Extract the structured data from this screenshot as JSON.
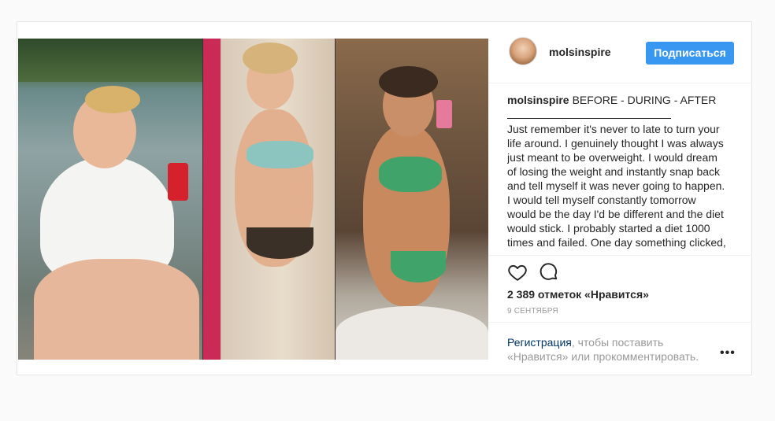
{
  "post": {
    "username": "molsinspire",
    "follow_label": "Подписаться",
    "caption_title": "BEFORE - DURING - AFTER",
    "caption_lines": [
      "Just remember it's never to late to turn your",
      "life around. I genuinely thought I was always",
      "just meant to be overweight. I would dream",
      "of losing the weight and instantly snap back",
      "and tell myself it was never going to happen.",
      "I would tell myself constantly tomorrow",
      "would be the day I'd be different and the diet",
      "would stick. I probably started a diet 1000",
      "times and failed. One day something clicked,"
    ],
    "likes": "2 389 отметок «Нравится»",
    "date": "9 СЕНТЯБРЯ",
    "login_link": "Регистрация",
    "login_text_1": ", чтобы поставить",
    "login_text_2": "«Нравится» или прокомментировать.",
    "more_label": "•••"
  },
  "icons": {
    "heart": "heart-icon",
    "comment": "comment-icon",
    "more": "more-options-icon"
  },
  "colors": {
    "follow_button": "#3897f0",
    "link": "#003569",
    "muted": "#999999"
  }
}
